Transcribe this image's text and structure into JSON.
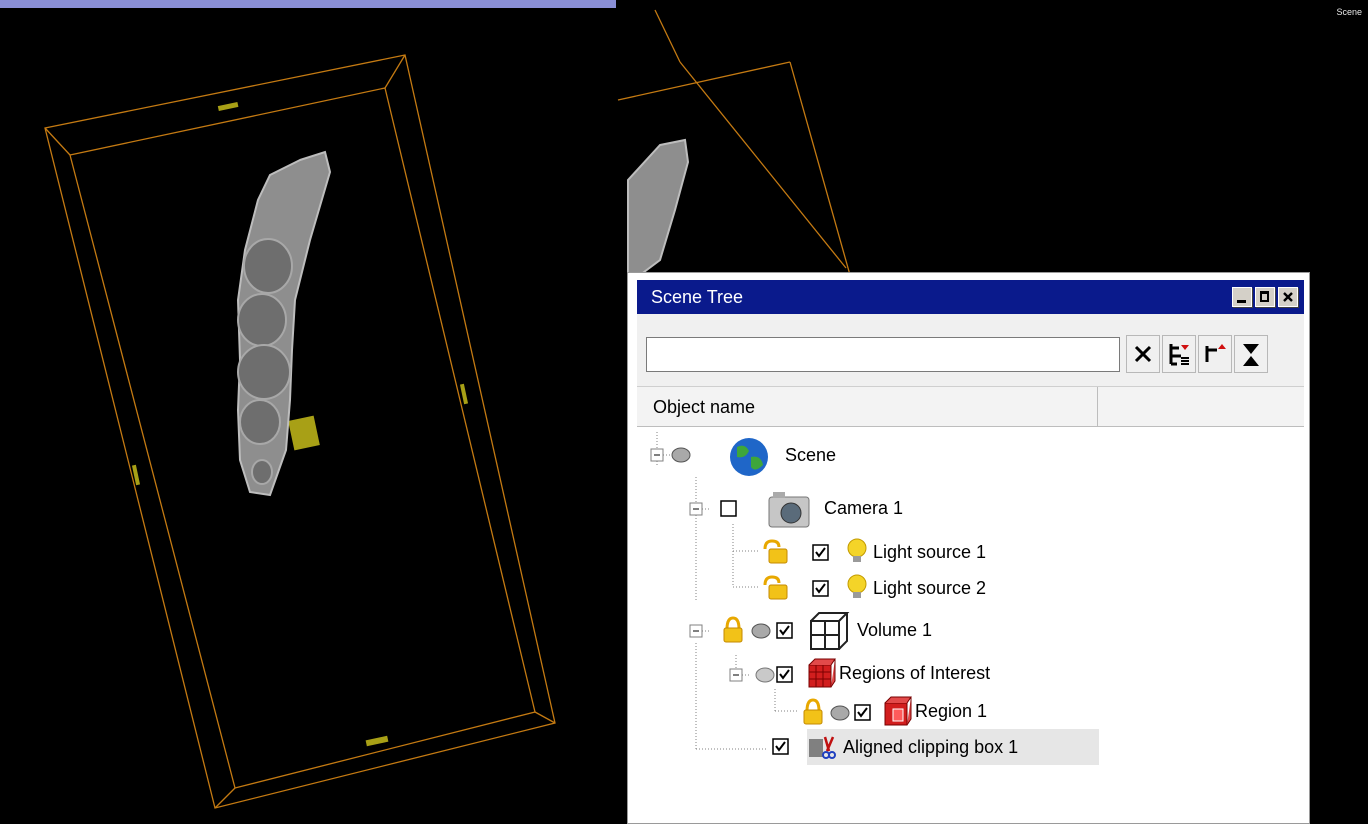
{
  "viewport": {
    "corner_label": "Scene"
  },
  "scene_tree": {
    "title": "Scene Tree",
    "search": {
      "value": "",
      "placeholder": ""
    },
    "column_header": "Object name",
    "items": [
      {
        "label": "Scene",
        "icon": "globe-icon"
      },
      {
        "label": "Camera 1",
        "icon": "camera-icon",
        "checked": false
      },
      {
        "label": "Light source 1",
        "icon": "bulb-icon",
        "checked": true
      },
      {
        "label": "Light source 2",
        "icon": "bulb-icon",
        "checked": true
      },
      {
        "label": "Volume 1",
        "icon": "volume-cube-icon",
        "checked": true
      },
      {
        "label": "Regions of Interest",
        "icon": "roi-cube-icon",
        "checked": true
      },
      {
        "label": "Region 1",
        "icon": "region-cube-icon",
        "checked": true
      },
      {
        "label": "Aligned clipping box 1",
        "icon": "clipping-icon",
        "checked": true,
        "selected": true
      }
    ]
  },
  "colors": {
    "titlebar": "#0a1a8c",
    "box_lines": "#c47a12",
    "selection": "#e6e6e6"
  }
}
